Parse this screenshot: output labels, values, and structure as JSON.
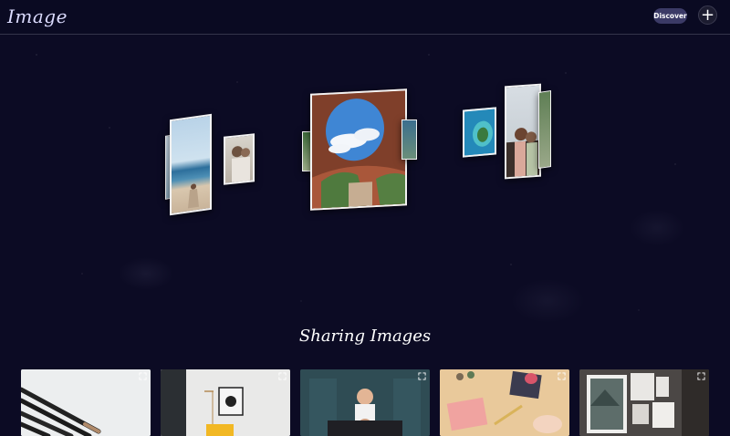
{
  "header": {
    "logo": "Image",
    "discover_label": "Discover",
    "add_label": "+"
  },
  "carousel": {
    "items": [
      {
        "name": "carousel-photo-beach-woman",
        "subject": "woman on beach"
      },
      {
        "name": "carousel-photo-couple",
        "subject": "couple"
      },
      {
        "name": "carousel-photo-canyon",
        "subject": "canyon arch with sky"
      },
      {
        "name": "carousel-photo-aerial-island",
        "subject": "aerial island"
      },
      {
        "name": "carousel-photo-couple-paris",
        "subject": "couple selfie"
      }
    ]
  },
  "section": {
    "title": "Sharing Images"
  },
  "grid": {
    "cards": [
      {
        "subject": "makeup brushes"
      },
      {
        "subject": "interior lamp"
      },
      {
        "subject": "father and child"
      },
      {
        "subject": "crafts table"
      },
      {
        "subject": "gallery wall"
      }
    ]
  }
}
